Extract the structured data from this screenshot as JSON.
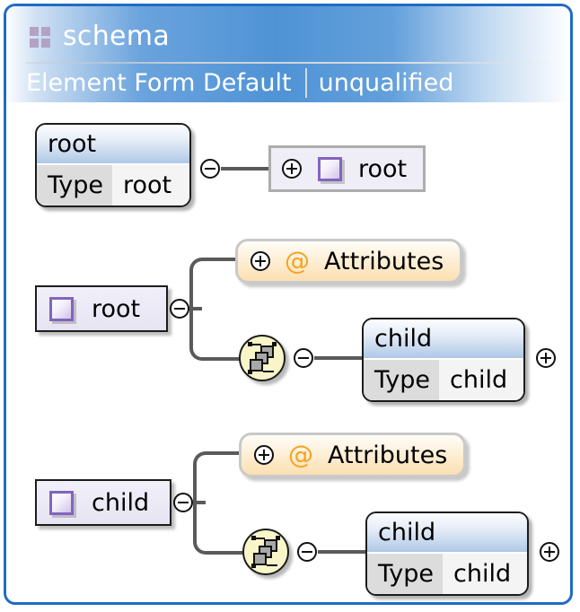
{
  "window": {
    "border_color": "#1f6cc4",
    "header": {
      "icon": "schema-grid-icon",
      "title": "schema",
      "property_name": "Element Form Default",
      "property_value": "unqualified",
      "separator": "|"
    }
  },
  "diagram": {
    "type": "xsd-schema-tree",
    "rows": [
      {
        "id": "row-root-type",
        "complex_type": {
          "title": "root",
          "key": "Type",
          "value": "root"
        },
        "toggle": "minus",
        "element_ref": {
          "icon": "purple-square-icon",
          "label": "root",
          "toggle": "plus",
          "frame": "gray"
        }
      },
      {
        "id": "row-root-content",
        "element_ref": {
          "icon": "purple-square-icon",
          "label": "root",
          "frame": "dark"
        },
        "toggle": "minus",
        "branches": [
          {
            "type": "attributes",
            "toggle": "plus",
            "at_sign": "@",
            "label": "Attributes"
          },
          {
            "type": "sequence",
            "icon": "sequence-icon",
            "toggle": "minus",
            "complex_type": {
              "title": "child",
              "key": "Type",
              "value": "child"
            },
            "trailing_toggle": "plus"
          }
        ]
      },
      {
        "id": "row-child-content",
        "element_ref": {
          "icon": "purple-square-icon",
          "label": "child",
          "frame": "dark"
        },
        "toggle": "minus",
        "branches": [
          {
            "type": "attributes",
            "toggle": "plus",
            "at_sign": "@",
            "label": "Attributes"
          },
          {
            "type": "sequence",
            "icon": "sequence-icon",
            "toggle": "minus",
            "complex_type": {
              "title": "child",
              "key": "Type",
              "value": "child"
            },
            "trailing_toggle": "plus"
          }
        ]
      }
    ]
  },
  "colors": {
    "window_border": "#1f6cc4",
    "header_blue": "#4f93d6",
    "attribute_orange": "#f5a21e",
    "element_purple": "#8265bd",
    "sequence_yellow": "#f8f6c8",
    "connector_gray": "#5a5a5a"
  }
}
